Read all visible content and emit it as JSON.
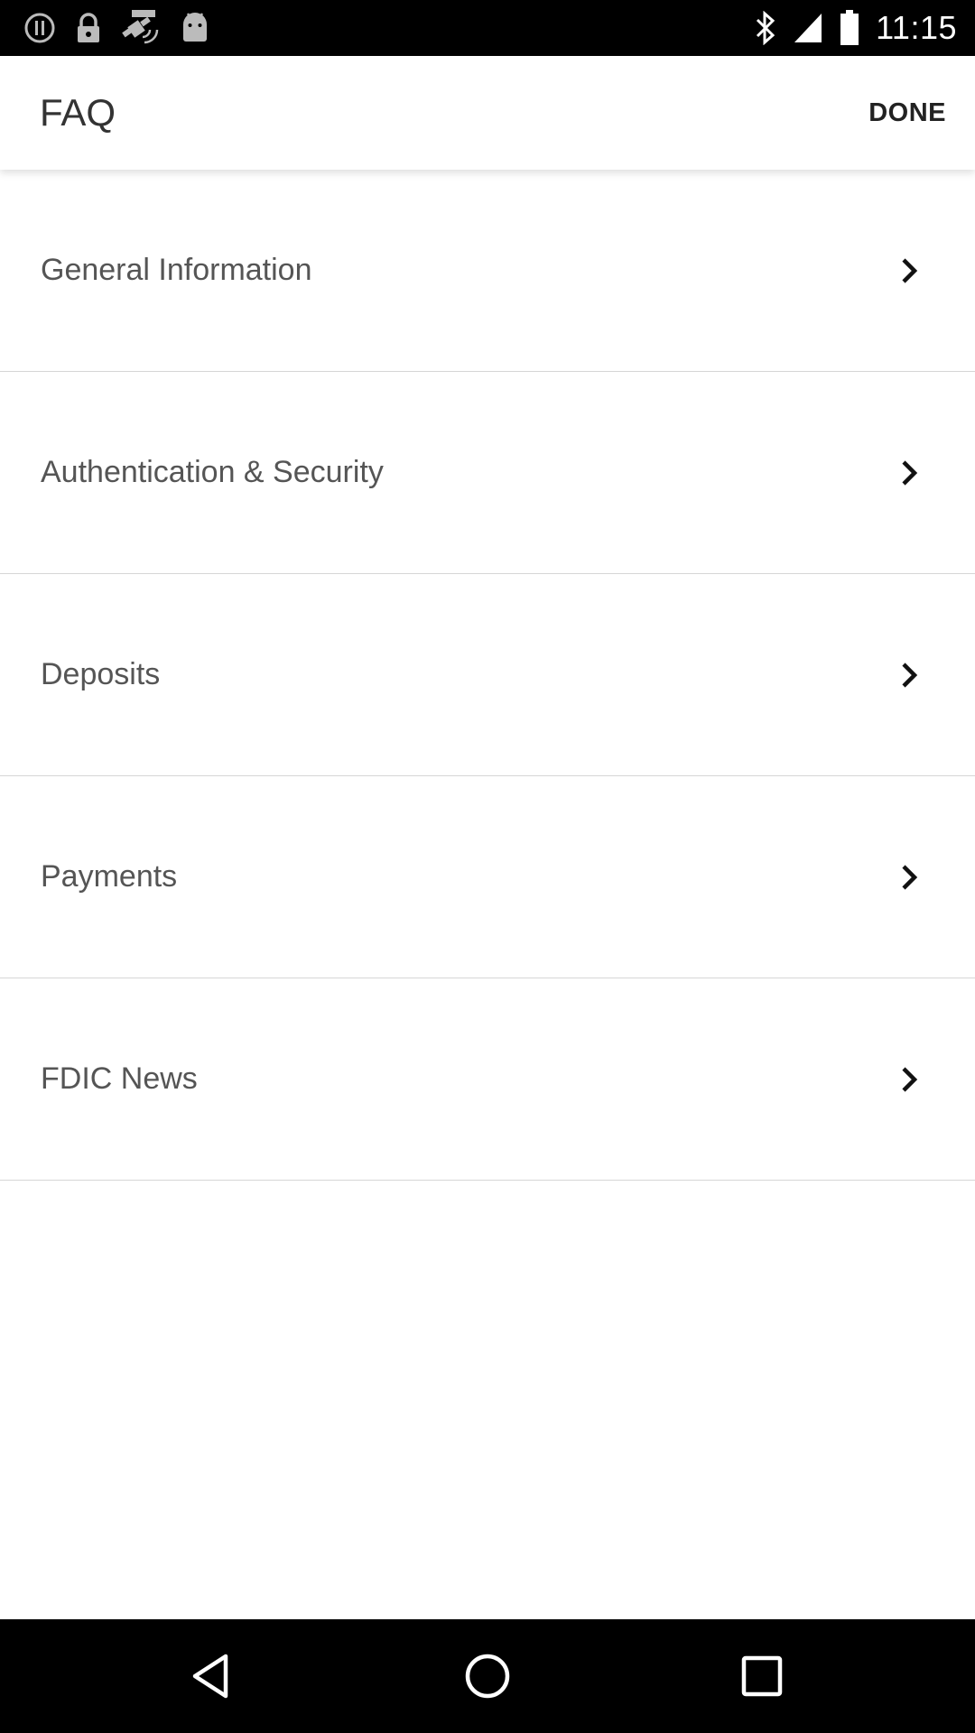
{
  "status_bar": {
    "time": "11:15",
    "left_icons": [
      "alert-icon",
      "lock-icon",
      "fake-gps-icon",
      "android-icon"
    ],
    "right_icons": [
      "bluetooth-icon",
      "signal-icon",
      "battery-icon"
    ]
  },
  "header": {
    "title": "FAQ",
    "done_label": "DONE"
  },
  "faq_items": [
    {
      "label": "General Information",
      "icon": "chevron-right-icon"
    },
    {
      "label": "Authentication & Security",
      "icon": "chevron-right-icon"
    },
    {
      "label": "Deposits",
      "icon": "chevron-right-icon"
    },
    {
      "label": "Payments",
      "icon": "chevron-right-icon"
    },
    {
      "label": "FDIC News",
      "icon": "chevron-right-icon"
    }
  ],
  "nav_bar": {
    "buttons": [
      "back-icon",
      "home-icon",
      "recents-icon"
    ]
  },
  "colors": {
    "status_bar_bg": "#000000",
    "page_bg": "#ffffff",
    "divider": "#d6d6d6",
    "label_text": "#555555"
  }
}
